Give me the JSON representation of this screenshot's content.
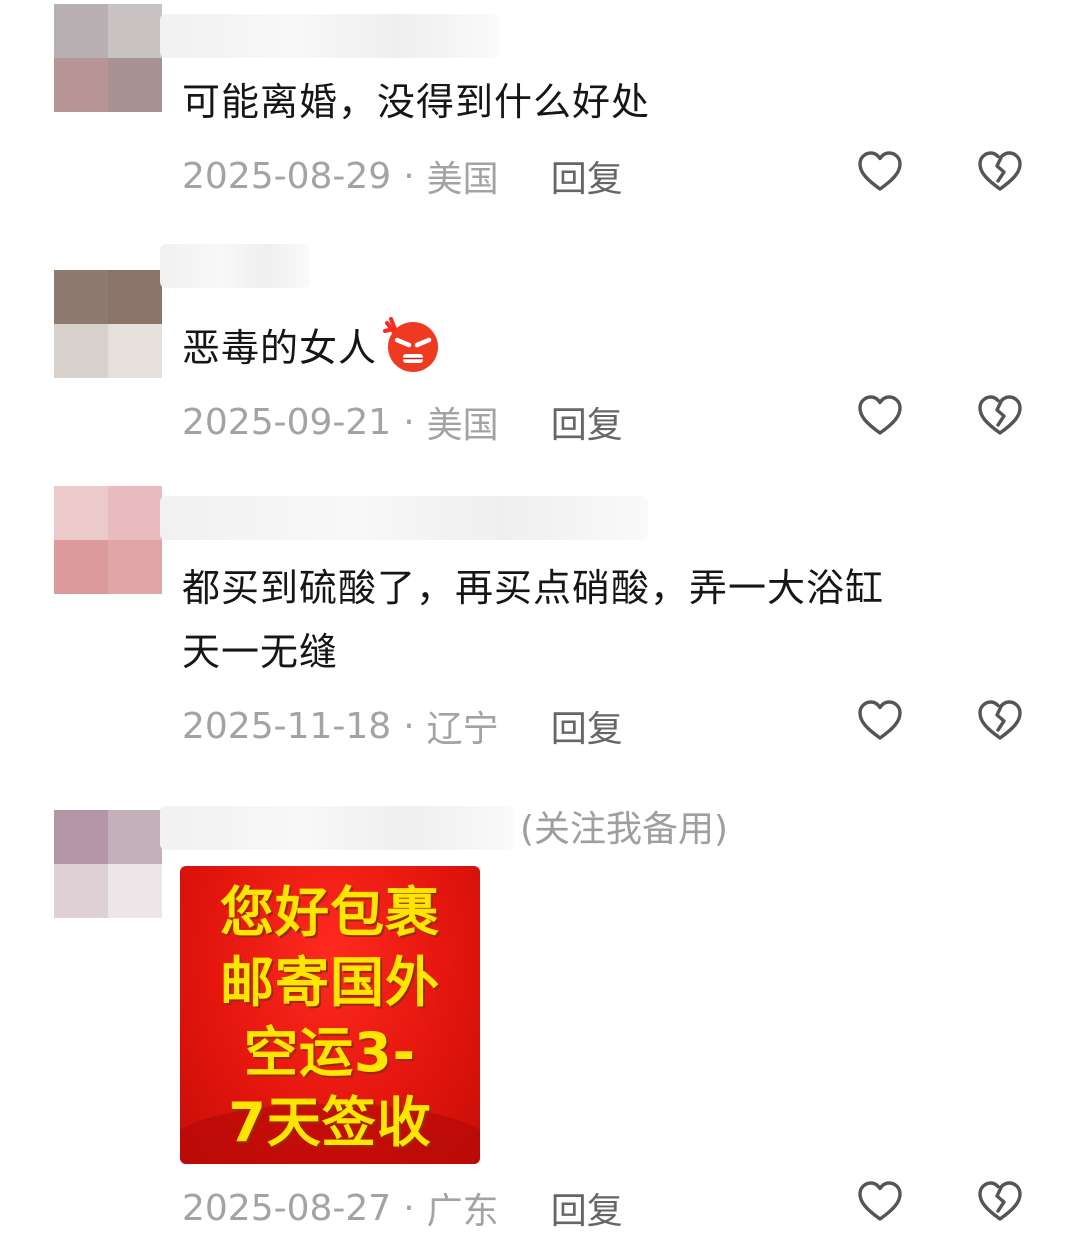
{
  "comments": [
    {
      "text": "可能离婚，没得到什么好处",
      "date": "2025-08-29",
      "location": "美国",
      "reply": "回复"
    },
    {
      "text": "恶毒的女人",
      "emoji": "angry-face-emoji",
      "date": "2025-09-21",
      "location": "美国",
      "reply": "回复"
    },
    {
      "text_line1": "都买到硫酸了，再买点硝酸，弄一大浴缸",
      "text_line2": "天一无缝",
      "date": "2025-11-18",
      "location": "辽宁",
      "reply": "回复"
    },
    {
      "name_suffix": "(关注我备用)",
      "image_lines": [
        "您好包裹",
        "邮寄国外",
        "空运3-",
        "7天签收"
      ],
      "date": "2025-08-27",
      "location": "广东",
      "reply": "回复"
    }
  ],
  "meta_separator": "·",
  "icons": {
    "like": "heart-outline-icon",
    "dislike": "broken-heart-icon"
  },
  "colors": {
    "meta_text": "#a3a3a3",
    "reply_text": "#666666",
    "ad_background": "#e4160e",
    "ad_text": "#ffe600"
  }
}
